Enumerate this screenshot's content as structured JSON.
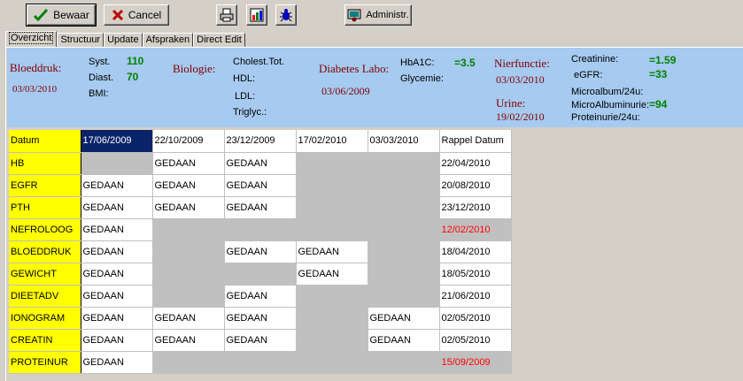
{
  "toolbar": {
    "save_label": "Bewaar",
    "cancel_label": "Cancel",
    "admin_label": "Administr."
  },
  "tabs": [
    "Overzicht",
    "Structuur",
    "Update",
    "Afspraken",
    "Direct Edit"
  ],
  "summary": {
    "bloeddruk_label": "Bloeddruk:",
    "bloeddruk_date": "03/03/2010",
    "syst_label": "Syst.",
    "syst_value": "110",
    "diast_label": "Diast.",
    "diast_value": "70",
    "bmi_label": "BMI:",
    "biologie_label": "Biologie:",
    "cholest_label": "Cholest.Tot.",
    "hdl_label": "HDL:",
    "ldl_label": "LDL:",
    "trigl_label": "Triglyc.:",
    "diabetes_label": "Diabetes Labo:",
    "diabetes_date": "03/06/2009",
    "hba1c_label": "HbA1C:",
    "hba1c_value": "=3.5",
    "glycemie_label": "Glycemie:",
    "nier_label": "Nierfunctie:",
    "nier_date": "03/03/2010",
    "urine_label": "Urine:",
    "urine_date": "19/02/2010",
    "creatinine_label": "Creatinine:",
    "creatinine_value": "=1.59",
    "egfr_label": "eGFR:",
    "egfr_value": "=33",
    "microalb_label": "Microalbum/24u:",
    "microalbuminurie_label": "MicroAlbuminurie:",
    "microalbuminurie_value": "=94",
    "proteinurie_label": "Proteinurie/24u:"
  },
  "grid": {
    "header_label": "Datum",
    "dates": [
      "17/06/2009",
      "22/10/2009",
      "23/12/2009",
      "17/02/2010",
      "03/03/2010"
    ],
    "rappel_header": "Rappel Datum",
    "rows": [
      {
        "name": "HB",
        "cells": [
          "",
          "GEDAAN",
          "GEDAAN",
          "",
          ""
        ],
        "rappel": "22/04/2010",
        "overdue": false
      },
      {
        "name": "EGFR",
        "cells": [
          "GEDAAN",
          "GEDAAN",
          "GEDAAN",
          "",
          ""
        ],
        "rappel": "20/08/2010",
        "overdue": false
      },
      {
        "name": "PTH",
        "cells": [
          "GEDAAN",
          "GEDAAN",
          "GEDAAN",
          "",
          ""
        ],
        "rappel": "23/12/2010",
        "overdue": false
      },
      {
        "name": "NEFROLOOG",
        "cells": [
          "GEDAAN",
          "",
          "",
          "",
          ""
        ],
        "rappel": "12/02/2010",
        "overdue": true
      },
      {
        "name": "BLOEDDRUK",
        "cells": [
          "GEDAAN",
          "",
          "GEDAAN",
          "GEDAAN",
          ""
        ],
        "rappel": "18/04/2010",
        "overdue": false
      },
      {
        "name": "GEWICHT",
        "cells": [
          "GEDAAN",
          "",
          "",
          "GEDAAN",
          ""
        ],
        "rappel": "18/05/2010",
        "overdue": false
      },
      {
        "name": "DIEETADV",
        "cells": [
          "GEDAAN",
          "",
          "GEDAAN",
          "",
          ""
        ],
        "rappel": "21/06/2010",
        "overdue": false
      },
      {
        "name": "IONOGRAM",
        "cells": [
          "GEDAAN",
          "GEDAAN",
          "GEDAAN",
          "",
          "GEDAAN"
        ],
        "rappel": "02/05/2010",
        "overdue": false
      },
      {
        "name": "CREATIN",
        "cells": [
          "GEDAAN",
          "GEDAAN",
          "GEDAAN",
          "",
          "GEDAAN"
        ],
        "rappel": "02/05/2010",
        "overdue": false
      },
      {
        "name": "PROTEINUR",
        "cells": [
          "GEDAAN",
          "",
          "",
          "",
          ""
        ],
        "rappel": "15/09/2009",
        "overdue": true
      }
    ]
  },
  "colors": {
    "summary_bg": "#a6caf0",
    "label_red": "#800000",
    "value_green": "#008000",
    "row_header_yellow": "#ffff00",
    "overdue_red": "#ff0000",
    "selected_bg": "#0a246a"
  },
  "icons": [
    "check-icon",
    "x-icon",
    "print-icon",
    "chart-icon",
    "bug-icon",
    "admin-icon"
  ]
}
